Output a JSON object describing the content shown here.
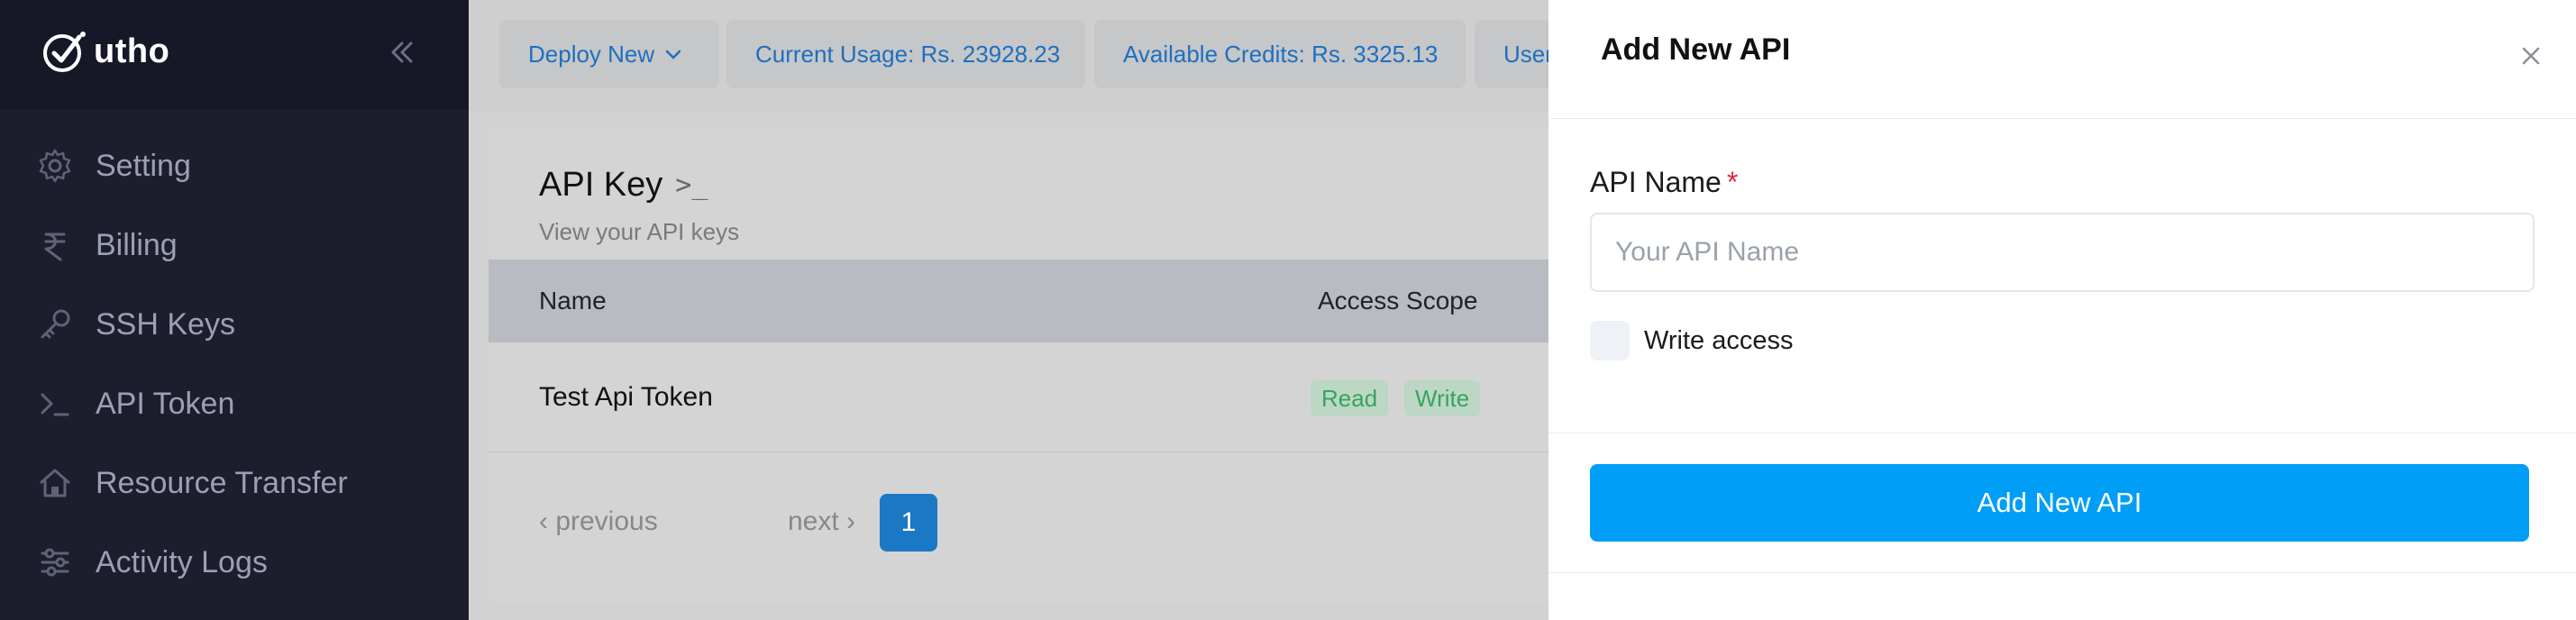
{
  "sidebar": {
    "logo_text": "utho",
    "items": [
      {
        "label": "Setting",
        "icon": "gear-icon"
      },
      {
        "label": "Billing",
        "icon": "rupee-icon"
      },
      {
        "label": "SSH Keys",
        "icon": "key-icon"
      },
      {
        "label": "API Token",
        "icon": "terminal-icon"
      },
      {
        "label": "Resource Transfer",
        "icon": "house-icon"
      },
      {
        "label": "Activity Logs",
        "icon": "sliders-icon"
      }
    ]
  },
  "topbar": {
    "deploy_label": "Deploy New",
    "usage_label": "Current Usage: Rs. 23928.23",
    "credits_label": "Available Credits: Rs. 3325.13",
    "user_label": "User"
  },
  "card": {
    "title": "API Key",
    "prompt": ">_",
    "subtitle": "View your API keys",
    "columns": [
      "Name",
      "Access Scope"
    ],
    "rows": [
      {
        "name": "Test Api Token",
        "scopes": [
          "Read",
          "Write"
        ]
      }
    ],
    "pagination": {
      "prev": "‹ previous",
      "page": "1",
      "next": "next ›"
    }
  },
  "drawer": {
    "title": "Add New API",
    "field_label": "API Name",
    "required_mark": "*",
    "placeholder": "Your API Name",
    "value": "",
    "checkbox_label": "Write access",
    "submit_label": "Add New API"
  },
  "colors": {
    "accent": "#009ef7",
    "sidebar_bg": "#1c1e2d",
    "badge_green": "#37a35f",
    "required_red": "#e5223b"
  }
}
